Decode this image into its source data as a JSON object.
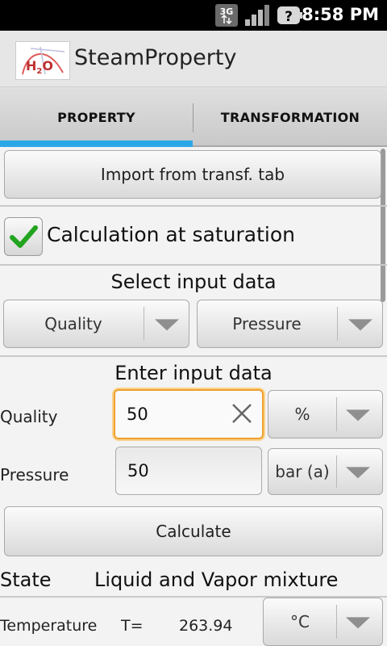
{
  "status_bar": {
    "network_badge": "3G",
    "time": "8:58 PM"
  },
  "app": {
    "title": "SteamProperty",
    "logo_text": "H2O"
  },
  "tabs": [
    {
      "label": "PROPERTY",
      "selected": true
    },
    {
      "label": "TRANSFORMATION",
      "selected": false
    }
  ],
  "import_button": "Import from transf. tab",
  "saturation": {
    "label": "Calculation at saturation",
    "checked": true
  },
  "select_input": {
    "title": "Select input data",
    "first": "Quality",
    "second": "Pressure"
  },
  "enter_input": {
    "title": "Enter input data",
    "rows": [
      {
        "label": "Quality",
        "value": "50",
        "unit": "%"
      },
      {
        "label": "Pressure",
        "value": "50",
        "unit": "bar (a)"
      }
    ]
  },
  "calculate_button": "Calculate",
  "result": {
    "state_label": "State",
    "state_value": "Liquid and Vapor mixture",
    "temperature_label": "Temperature",
    "temperature_symbol": "T=",
    "temperature_value": "263.94",
    "temperature_unit": "°C"
  },
  "colors": {
    "tab_indicator": "#2aa7e6",
    "focus_border": "#f0a030",
    "check_mark": "#22a41f"
  }
}
